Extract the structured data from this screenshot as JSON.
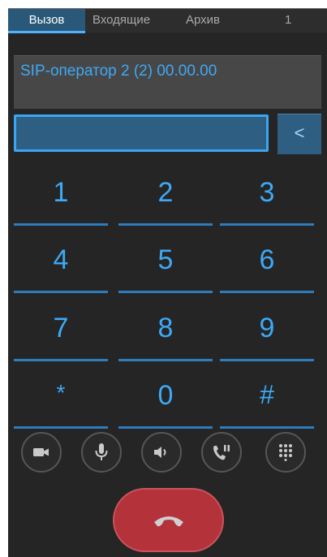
{
  "tabs": {
    "call": "Вызов",
    "incoming": "Входящие",
    "archive": "Архив",
    "count": "1"
  },
  "status": {
    "text": "SIP-оператор 2 (2) 00.00.00"
  },
  "dial_input": {
    "value": ""
  },
  "backspace_label": "<",
  "keypad": {
    "k1": "1",
    "k2": "2",
    "k3": "3",
    "k4": "4",
    "k5": "5",
    "k6": "6",
    "k7": "7",
    "k8": "8",
    "k9": "9",
    "star": "*",
    "k0": "0",
    "hash": "#"
  },
  "actions": {
    "icons": [
      "video-camera-icon",
      "microphone-icon",
      "speaker-icon",
      "hold-call-icon",
      "dialpad-icon"
    ]
  },
  "hangup": {
    "icon": "hang-up-icon",
    "color": "#c8343e"
  },
  "colors": {
    "accent": "#3ea9f6",
    "background": "#252525",
    "active_tab": "#2a5878"
  }
}
